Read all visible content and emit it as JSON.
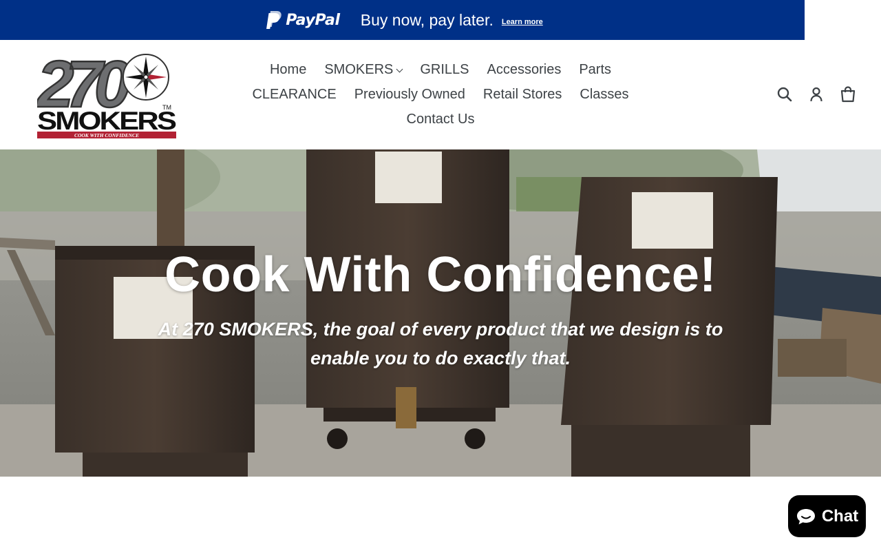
{
  "paypal_banner": {
    "brand": "PayPal",
    "message": "Buy now, pay later.",
    "learn_more": "Learn more",
    "bg_color": "#003087"
  },
  "logo": {
    "number": "270",
    "name": "SMOKERS",
    "trademark": "TM",
    "tagline": "COOK WITH CONFIDENCE"
  },
  "nav": {
    "row1": [
      "Home",
      "SMOKERS",
      "GRILLS",
      "Accessories",
      "Parts"
    ],
    "row2": [
      "CLEARANCE",
      "Previously Owned",
      "Retail Stores",
      "Classes"
    ],
    "row3": [
      "Contact Us"
    ]
  },
  "header_icons": [
    "search-icon",
    "account-icon",
    "cart-icon"
  ],
  "hero": {
    "title": "Cook With Confidence!",
    "subtitle": "At 270 SMOKERS, the goal of every product that we design is to enable you to do exactly that."
  },
  "chat": {
    "label": "Chat"
  }
}
